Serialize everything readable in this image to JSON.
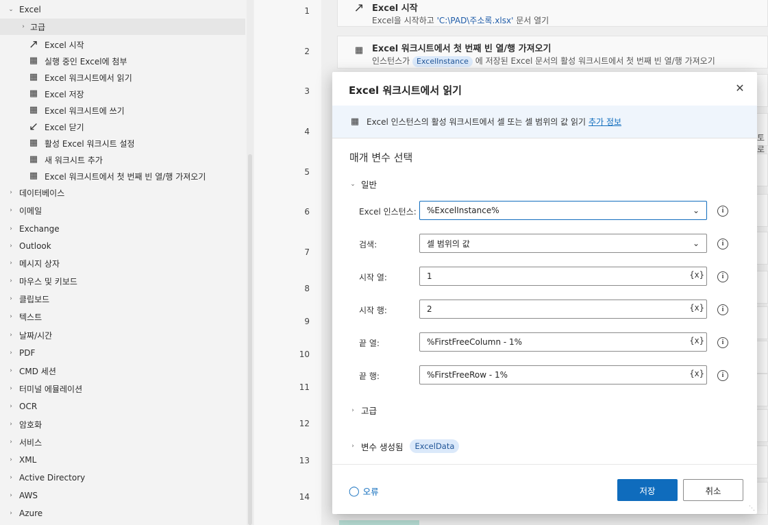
{
  "actions_panel": {
    "excel_group": "Excel",
    "advanced_sub": "고급",
    "excel_actions": [
      {
        "label": "Excel 시작",
        "icon": "arrow-up-right-icon"
      },
      {
        "label": "실행 중인 Excel에 첨부",
        "icon": "excel-sheet-icon"
      },
      {
        "label": "Excel 워크시트에서 읽기",
        "icon": "excel-sheet-icon"
      },
      {
        "label": "Excel 저장",
        "icon": "excel-sheet-icon"
      },
      {
        "label": "Excel 워크시트에 쓰기",
        "icon": "excel-sheet-icon"
      },
      {
        "label": "Excel 닫기",
        "icon": "arrow-down-left-icon"
      },
      {
        "label": "활성 Excel 워크시트 설정",
        "icon": "excel-sheet-icon"
      },
      {
        "label": "새 워크시트 추가",
        "icon": "excel-sheet-icon"
      },
      {
        "label": "Excel 워크시트에서 첫 번째 빈 열/행 가져오기",
        "icon": "excel-sheet-icon"
      }
    ],
    "groups": [
      "데이터베이스",
      "이메일",
      "Exchange",
      "Outlook",
      "메시지 상자",
      "마우스 및 키보드",
      "클립보드",
      "텍스트",
      "날짜/시간",
      "PDF",
      "CMD 세션",
      "터미널 에뮬레이션",
      "OCR",
      "암호화",
      "서비스",
      "XML",
      "Active Directory",
      "AWS",
      "Azure"
    ]
  },
  "line_numbers": [
    "1",
    "2",
    "3",
    "4",
    "5",
    "6",
    "7",
    "8",
    "9",
    "10",
    "11",
    "12",
    "13",
    "14"
  ],
  "flow": {
    "step1": {
      "title": "Excel 시작",
      "desc_prefix": "Excel을 시작하고 ",
      "desc_path": "'C:\\PAD\\주소록.xlsx'",
      "desc_suffix": " 문서 열기"
    },
    "step2": {
      "title": "Excel 워크시트에서 첫 번째 빈 열/행 가져오기",
      "desc_prefix": "인스턴스가 ",
      "desc_pill": "ExcelInstance",
      "desc_suffix": " 에 저장된 Excel 문서의 활성 워크시트에서 첫 번째 빈 열/행 가져오기"
    },
    "partial_text": "토로"
  },
  "dialog": {
    "title": "Excel 워크시트에서 읽기",
    "info_text": "Excel 인스턴스의 활성 워크시트에서 셀 또는 셀 범위의 값 읽기",
    "info_link": "추가 정보",
    "section_title": "매개 변수 선택",
    "general_group": "일반",
    "fields": [
      {
        "label": "Excel 인스턴스:",
        "value": "%ExcelInstance%"
      },
      {
        "label": "검색:",
        "value": "셀 범위의 값"
      },
      {
        "label": "시작 열:",
        "value": "1"
      },
      {
        "label": "시작 행:",
        "value": "2"
      },
      {
        "label": "끝 열:",
        "value": "%FirstFreeColumn - 1%"
      },
      {
        "label": "끝 행:",
        "value": "%FirstFreeRow - 1%"
      }
    ],
    "var_button": "{x}",
    "advanced_group": "고급",
    "vars_group": "변수 생성됨",
    "vars_pill": "ExcelData",
    "error_link": "오류",
    "save": "저장",
    "cancel": "취소"
  }
}
